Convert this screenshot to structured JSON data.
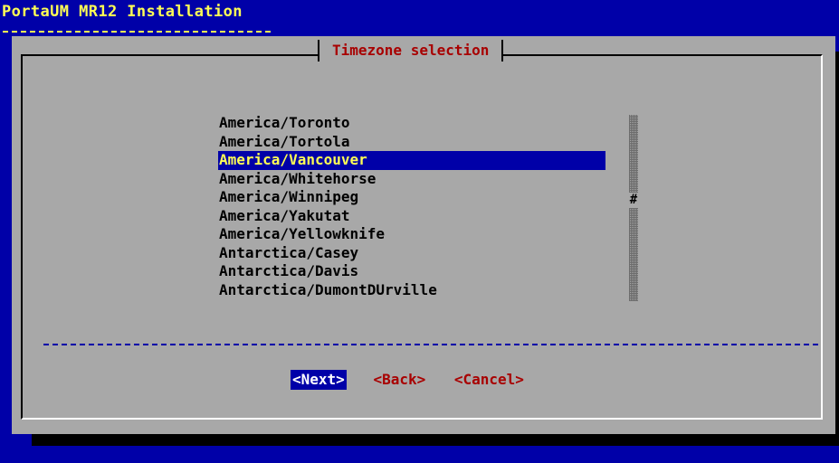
{
  "app": {
    "backtitle": "PortaUM MR12 Installation"
  },
  "dialog": {
    "title": "Timezone selection",
    "timezones": [
      "America/Toronto",
      "America/Tortola",
      "America/Vancouver",
      "America/Whitehorse",
      "America/Winnipeg",
      "America/Yakutat",
      "America/Yellowknife",
      "Antarctica/Casey",
      "Antarctica/Davis",
      "Antarctica/DumontDUrville"
    ],
    "selected_index": 2,
    "scroll_thumb": "#",
    "buttons": {
      "next": "<Next>",
      "back": "<Back>",
      "cancel": "<Cancel>"
    }
  },
  "colors": {
    "background": "#0000a8",
    "dialog": "#a8a8a8",
    "highlight_text": "#ffff55",
    "accent_red": "#a80000"
  }
}
